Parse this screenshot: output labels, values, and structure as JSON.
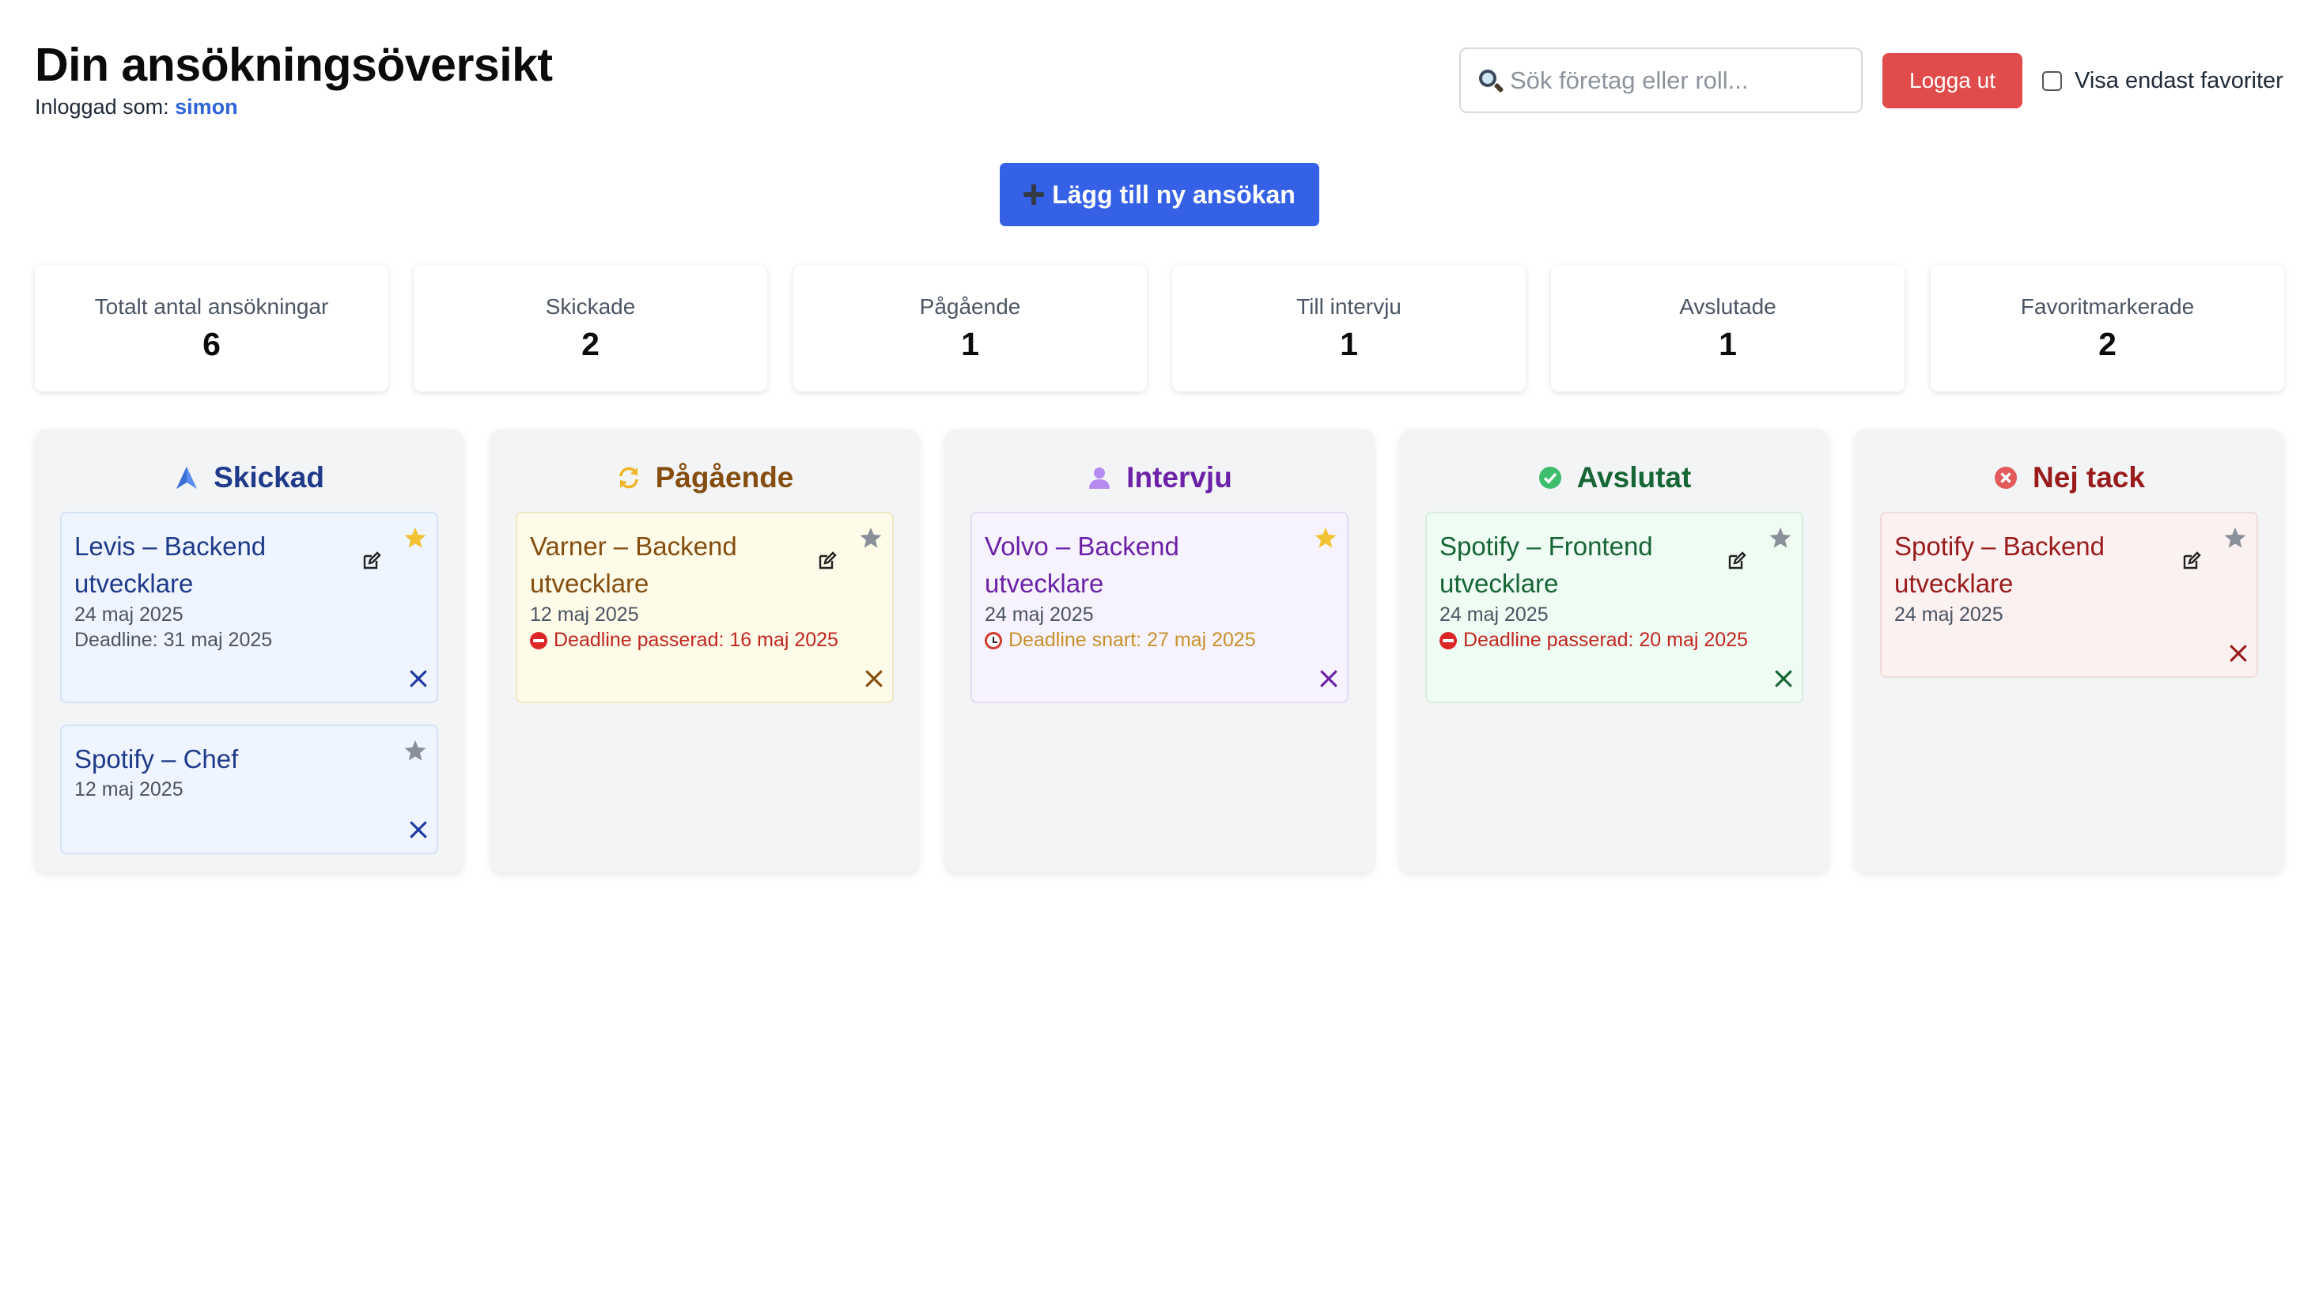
{
  "header": {
    "title": "Din ansökningsöversikt",
    "user_prefix": "Inloggad som:",
    "username": "simon"
  },
  "search": {
    "placeholder": "Sök företag eller roll..."
  },
  "logout_label": "Logga ut",
  "favorites_filter": {
    "label": "Visa endast favoriter",
    "checked": false
  },
  "add_button_label": "Lägg till ny ansökan",
  "stats": [
    {
      "label": "Totalt antal ansökningar",
      "value": "6"
    },
    {
      "label": "Skickade",
      "value": "2"
    },
    {
      "label": "Pågående",
      "value": "1"
    },
    {
      "label": "Till intervju",
      "value": "1"
    },
    {
      "label": "Avslutade",
      "value": "1"
    },
    {
      "label": "Favoritmarkerade",
      "value": "2"
    }
  ],
  "columns": [
    {
      "title": "Skickad",
      "icon": "paper-plane-icon",
      "colors": {
        "text": "#1e3a8a",
        "card_bg": "#eef5ff",
        "card_border": "#d4e2f7",
        "accent": "#1e3aa0"
      },
      "cards": [
        {
          "title": "Levis – Backend utvecklare",
          "date": "24 maj 2025",
          "deadline": "Deadline: 31 maj 2025",
          "deadline_status": "normal",
          "favorite": true
        },
        {
          "title": "Spotify – Chef",
          "date": "12 maj 2025",
          "favorite": false
        }
      ]
    },
    {
      "title": "Pågående",
      "icon": "refresh-icon",
      "colors": {
        "text": "#854d0e",
        "card_bg": "#fefbe8",
        "card_border": "#efe7c2",
        "accent": "#854d0e"
      },
      "cards": [
        {
          "title": "Varner – Backend utvecklare",
          "date": "12 maj 2025",
          "deadline": "Deadline passerad: 16 maj 2025",
          "deadline_status": "passed",
          "favorite": false
        }
      ]
    },
    {
      "title": "Intervju",
      "icon": "person-icon",
      "colors": {
        "text": "#6b21a8",
        "card_bg": "#f7f3fe",
        "card_border": "#e4dcf4",
        "accent": "#6b21a8"
      },
      "cards": [
        {
          "title": "Volvo – Backend utvecklare",
          "date": "24 maj 2025",
          "deadline": "Deadline snart: 27 maj 2025",
          "deadline_status": "soon",
          "favorite": true
        }
      ]
    },
    {
      "title": "Avslutat",
      "icon": "check-circle-icon",
      "colors": {
        "text": "#166534",
        "card_bg": "#effcf3",
        "card_border": "#d6eede",
        "accent": "#166534"
      },
      "cards": [
        {
          "title": "Spotify – Frontend utvecklare",
          "date": "24 maj 2025",
          "deadline": "Deadline passerad: 20 maj 2025",
          "deadline_status": "passed",
          "favorite": false
        }
      ]
    },
    {
      "title": "Nej tack",
      "icon": "x-circle-icon",
      "colors": {
        "text": "#991b1b",
        "card_bg": "#fcf1f1",
        "card_border": "#efdcdc",
        "accent": "#991b1b"
      },
      "cards": [
        {
          "title": "Spotify – Backend utvecklare",
          "date": "24 maj 2025",
          "favorite": false
        }
      ]
    }
  ],
  "icon_colors": {
    "star_active": "#f2c232",
    "star_inactive": "#8a9099",
    "deadline_passed": "#c0261f",
    "deadline_soon": "#c7912a",
    "deadline_normal": "#4b5563"
  }
}
